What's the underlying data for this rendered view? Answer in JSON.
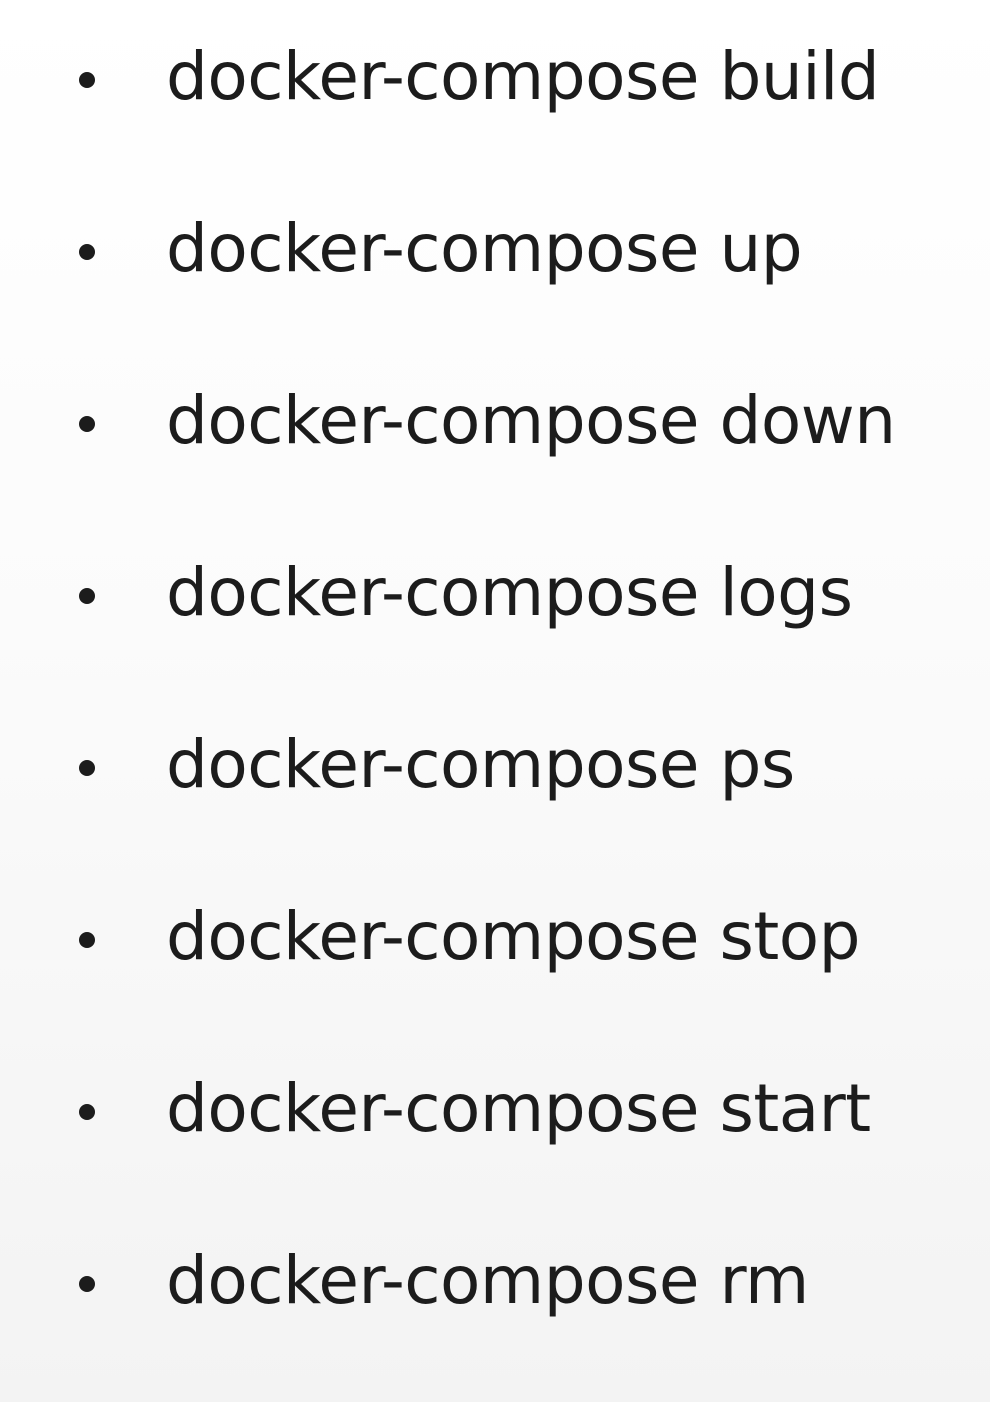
{
  "commands": [
    "docker-compose build",
    "docker-compose up",
    "docker-compose down",
    "docker-compose logs",
    "docker-compose ps",
    "docker-compose stop",
    "docker-compose start",
    "docker-compose rm"
  ]
}
